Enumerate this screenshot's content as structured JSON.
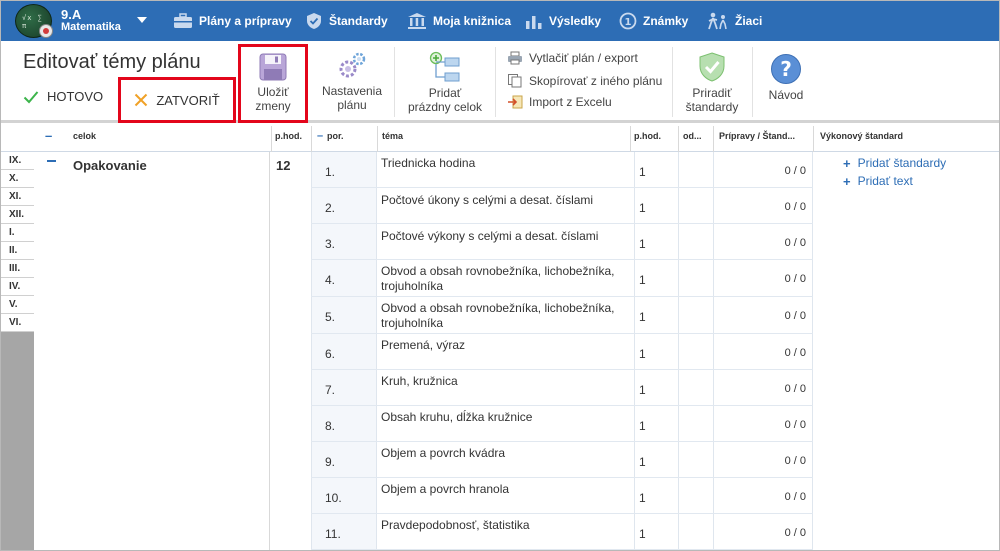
{
  "header": {
    "class_name": "9.A",
    "subject": "Matematika",
    "logo_text": "√x ∑ π",
    "nav": [
      {
        "label": "Plány a prípravy",
        "icon": "briefcase-icon"
      },
      {
        "label": "Štandardy",
        "icon": "shield-icon"
      },
      {
        "label": "Moja knižnica",
        "icon": "library-icon"
      },
      {
        "label": "Výsledky",
        "icon": "bar-chart-icon"
      },
      {
        "label": "Známky",
        "icon": "grade-icon"
      },
      {
        "label": "Žiaci",
        "icon": "students-icon"
      }
    ]
  },
  "toolbar": {
    "title": "Editovať témy plánu",
    "hotovo": "HOTOVO",
    "zatvorit": "ZATVORIŤ",
    "ulozit_line1": "Uložiť",
    "ulozit_line2": "zmeny",
    "nastavenia_line1": "Nastavenia",
    "nastavenia_line2": "plánu",
    "pridat_celok_line1": "Pridať",
    "pridat_celok_line2": "prázdny celok",
    "vytlacit": "Vytlačiť plán / export",
    "skopirovat": "Skopírovať z iného plánu",
    "import": "Import z Excelu",
    "priradit_line1": "Priradiť",
    "priradit_line2": "štandardy",
    "navod": "Návod"
  },
  "table": {
    "headers": {
      "minus": "–",
      "celok": "celok",
      "phod": "p.hod.",
      "por_minus": "–",
      "por": "por.",
      "tema": "téma",
      "phod2": "p.hod.",
      "od": "od...",
      "pripravy": "Prípravy / Štand...",
      "vykonovy": "Výkonový štandard"
    },
    "romans": [
      "IX.",
      "X.",
      "XI.",
      "XII.",
      "I.",
      "II.",
      "III.",
      "IV.",
      "V.",
      "VI."
    ],
    "celok": {
      "name": "Opakovanie",
      "hours": "12"
    },
    "rows": [
      {
        "por": "1.",
        "tema": "Triednicka hodina",
        "phod": "1",
        "pr": "0 / 0"
      },
      {
        "por": "2.",
        "tema": "Počtové úkony s celými a desat. číslami",
        "phod": "1",
        "pr": "0 / 0"
      },
      {
        "por": "3.",
        "tema": "Počtové výkony s celými a desat. číslami",
        "phod": "1",
        "pr": "0 / 0"
      },
      {
        "por": "4.",
        "tema": "Obvod a obsah rovnobežníka, lichobežníka, trojuholníka",
        "phod": "1",
        "pr": "0 / 0"
      },
      {
        "por": "5.",
        "tema": "Obvod a obsah rovnobežníka, lichobežníka, trojuholníka",
        "phod": "1",
        "pr": "0 / 0"
      },
      {
        "por": "6.",
        "tema": "Premená, výraz",
        "phod": "1",
        "pr": "0 / 0"
      },
      {
        "por": "7.",
        "tema": "Kruh, kružnica",
        "phod": "1",
        "pr": "0 / 0"
      },
      {
        "por": "8.",
        "tema": "Obsah kruhu, dĺžka kružnice",
        "phod": "1",
        "pr": "0 / 0"
      },
      {
        "por": "9.",
        "tema": "Objem a povrch kvádra",
        "phod": "1",
        "pr": "0 / 0"
      },
      {
        "por": "10.",
        "tema": "Objem a povrch hranola",
        "phod": "1",
        "pr": "0 / 0"
      },
      {
        "por": "11.",
        "tema": "Pravdepodobnosť, štatistika",
        "phod": "1",
        "pr": "0 / 0"
      }
    ],
    "add_standard": "Pridať štandardy",
    "add_text": "Pridať text"
  }
}
